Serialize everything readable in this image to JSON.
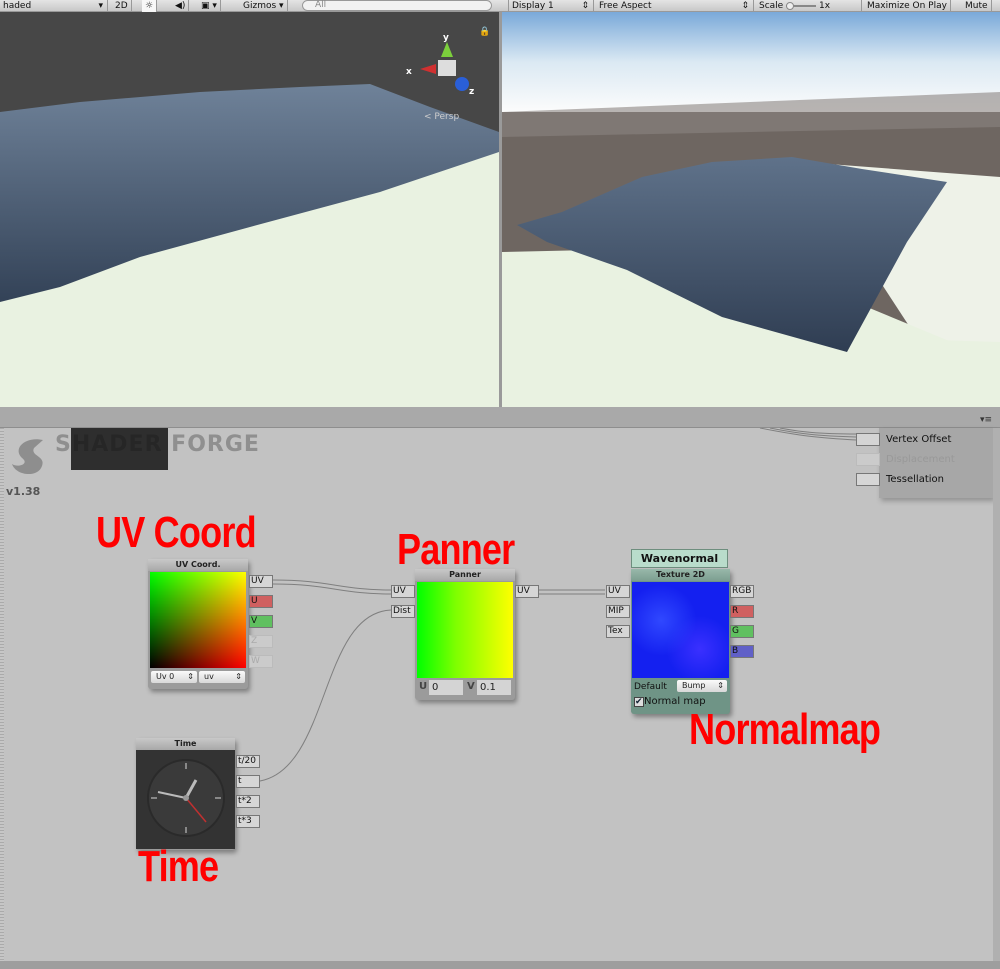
{
  "toolbar": {
    "shading": "haded",
    "mode_2d": "2D",
    "gizmos": "Gizmos",
    "search_placeholder": "All",
    "display": "Display 1",
    "aspect": "Free Aspect",
    "scale_label": "Scale",
    "scale_value": "1x",
    "maximize": "Maximize On Play",
    "mute": "Mute"
  },
  "scene": {
    "gizmo_axes": {
      "x": "x",
      "y": "y",
      "z": "z"
    },
    "projection": "Persp"
  },
  "editor": {
    "logo": "SHADER FORGE",
    "version": "v1.38",
    "main_inputs": [
      {
        "label": "Vertex Offset",
        "enabled": true
      },
      {
        "label": "Displacement",
        "enabled": false
      },
      {
        "label": "Tessellation",
        "enabled": true
      }
    ],
    "nodes": {
      "uv": {
        "title": "UV Coord.",
        "outputs": [
          "UV",
          "U",
          "V",
          "Z",
          "W"
        ],
        "channel": "Uv 0",
        "mode": "uv"
      },
      "panner": {
        "title": "Panner",
        "inputs": [
          "UV",
          "Dist"
        ],
        "outputs": [
          "UV"
        ],
        "u_label": "U",
        "u_value": "0",
        "v_label": "V",
        "v_value": "0.1"
      },
      "texture": {
        "name": "Wavenormal",
        "title": "Texture 2D",
        "inputs": [
          "UV",
          "MIP",
          "Tex"
        ],
        "outputs": [
          "RGB",
          "R",
          "G",
          "B"
        ],
        "default_label": "Default",
        "default_value": "Bump",
        "normal_map_label": "Normal map",
        "normal_map_checked": true
      },
      "time": {
        "title": "Time",
        "outputs": [
          "t/20",
          "t",
          "t*2",
          "t*3"
        ]
      }
    },
    "annotations": {
      "uv": "UV Coord",
      "panner": "Panner",
      "normalmap": "Normalmap",
      "time": "Time"
    }
  },
  "colors": {
    "annotation": "#ff0000",
    "port_r": "#d06060",
    "port_g": "#60c060",
    "port_b": "#6060c8"
  }
}
